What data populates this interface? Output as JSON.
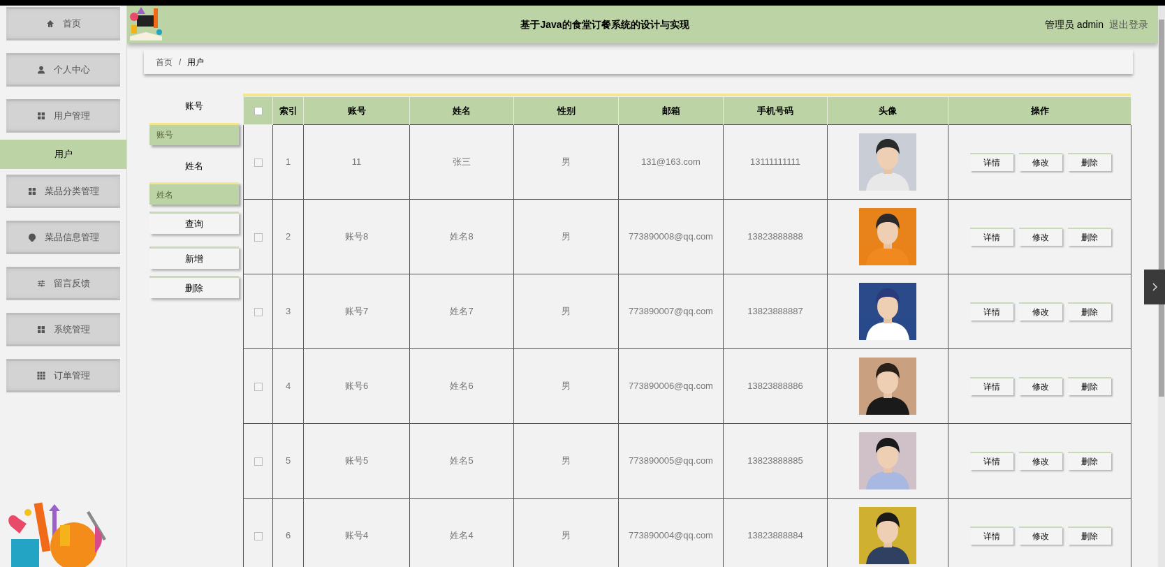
{
  "menu": [
    {
      "label": "首页",
      "kind": "menu",
      "selected": false
    },
    {
      "label": "个人中心",
      "kind": "menu",
      "selected": false
    },
    {
      "label": "用户管理",
      "kind": "menu",
      "selected": false
    },
    {
      "label": "用户",
      "kind": "submenu",
      "selected": true
    },
    {
      "label": "菜品分类管理",
      "kind": "menu",
      "selected": false
    },
    {
      "label": "菜品信息管理",
      "kind": "menu",
      "selected": false
    },
    {
      "label": "留言反馈",
      "kind": "menu",
      "selected": false
    },
    {
      "label": "系统管理",
      "kind": "menu",
      "selected": false
    },
    {
      "label": "订单管理",
      "kind": "menu",
      "selected": false
    }
  ],
  "header": {
    "title": "基于Java的食堂订餐系统的设计与实现",
    "user": "管理员 admin",
    "logout": "退出登录"
  },
  "breadcrumb": [
    "首页",
    "/",
    "用户"
  ],
  "search": {
    "fields": [
      {
        "label": "账号",
        "placeholder": "账号"
      },
      {
        "label": "姓名",
        "placeholder": "姓名"
      }
    ],
    "buttons": [
      "查询",
      "新增",
      "删除"
    ]
  },
  "table": {
    "select_all": {
      "checked": false
    },
    "columns": [
      "索引",
      "账号",
      "姓名",
      "性别",
      "邮箱",
      "手机号码",
      "头像",
      "操作"
    ],
    "rows": [
      {
        "checked": false,
        "cells": [
          "1",
          "11",
          "张三",
          "男",
          "131@163.com",
          "13111111111"
        ],
        "actions": [
          "详情",
          "修改",
          "删除"
        ]
      },
      {
        "checked": false,
        "cells": [
          "2",
          "账号8",
          "姓名8",
          "男",
          "773890008@qq.com",
          "13823888888"
        ],
        "actions": [
          "详情",
          "修改",
          "删除"
        ]
      },
      {
        "checked": false,
        "cells": [
          "3",
          "账号7",
          "姓名7",
          "男",
          "773890007@qq.com",
          "13823888887"
        ],
        "actions": [
          "详情",
          "修改",
          "删除"
        ]
      },
      {
        "checked": false,
        "cells": [
          "4",
          "账号6",
          "姓名6",
          "男",
          "773890006@qq.com",
          "13823888886"
        ],
        "actions": [
          "详情",
          "修改",
          "删除"
        ]
      },
      {
        "checked": false,
        "cells": [
          "5",
          "账号5",
          "姓名5",
          "男",
          "773890005@qq.com",
          "13823888885"
        ],
        "actions": [
          "详情",
          "修改",
          "删除"
        ]
      },
      {
        "checked": false,
        "cells": [
          "6",
          "账号4",
          "姓名4",
          "男",
          "773890004@qq.com",
          "13823888884"
        ],
        "actions": [
          "详情",
          "修改",
          "删除"
        ]
      }
    ]
  }
}
